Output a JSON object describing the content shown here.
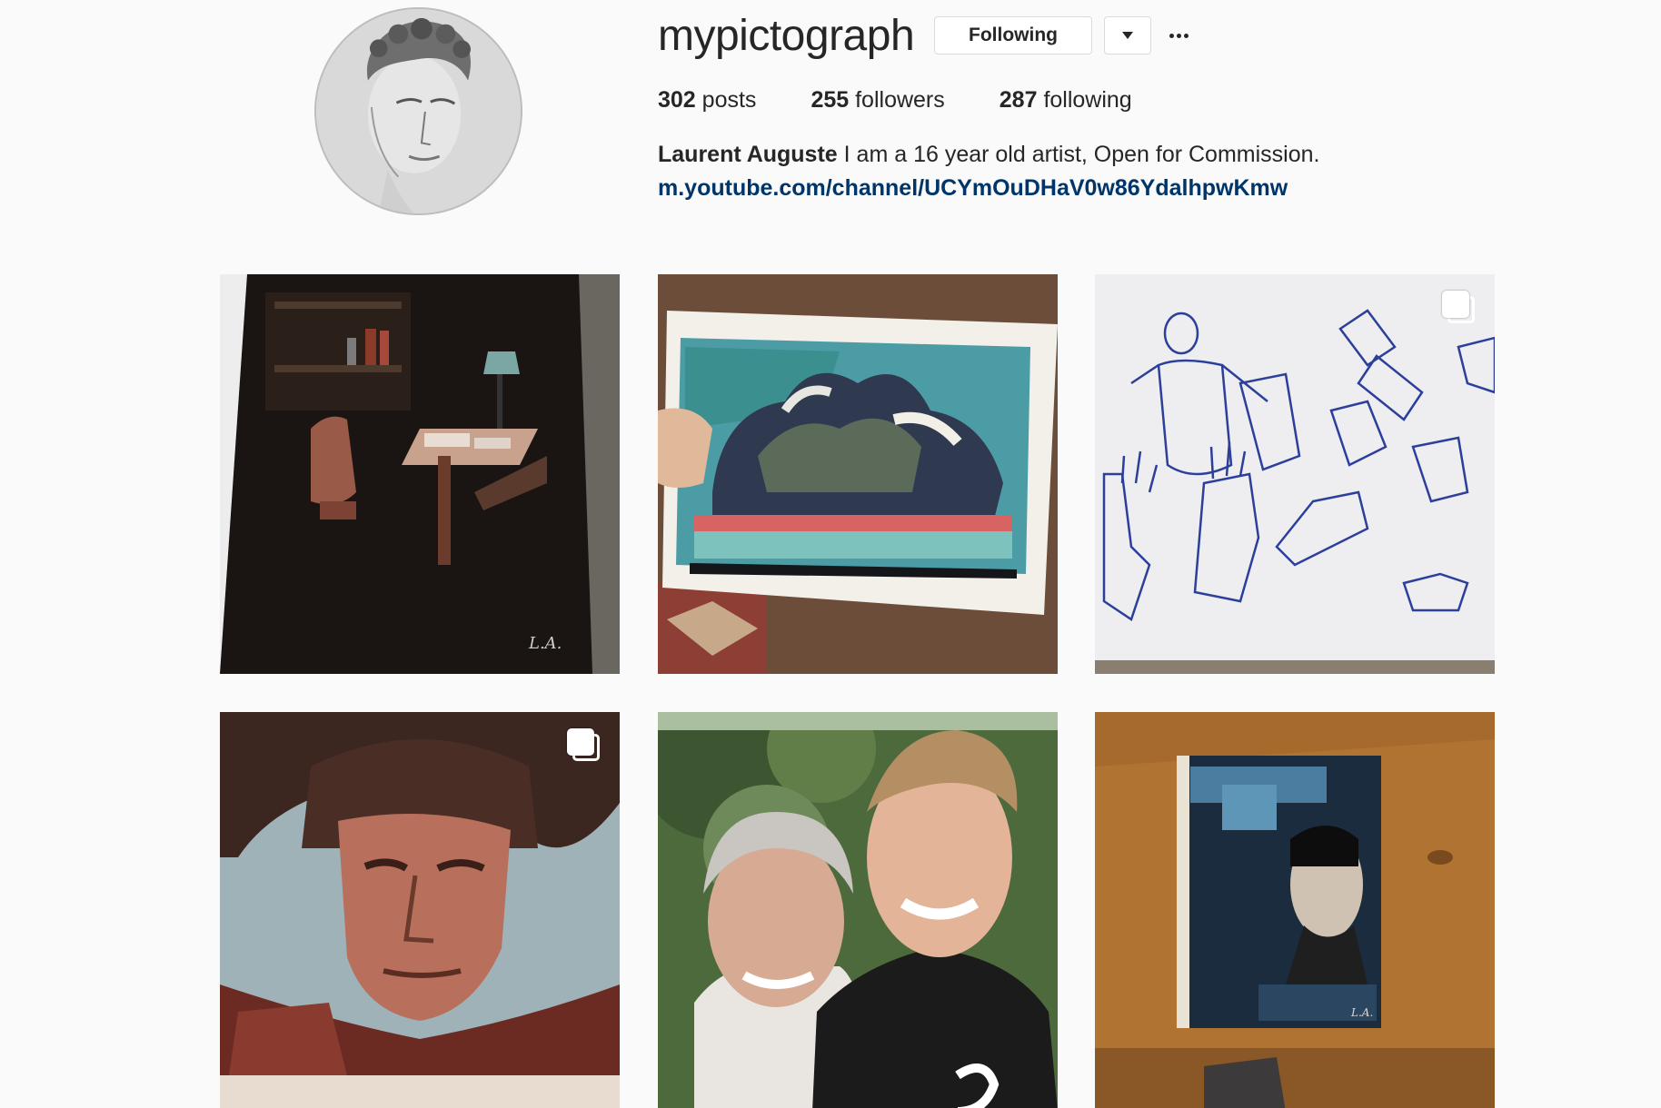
{
  "profile": {
    "username": "mypictograph",
    "follow_label": "Following",
    "posts_count": "302",
    "posts_label": "posts",
    "followers_count": "255",
    "followers_label": "followers",
    "following_count": "287",
    "following_label": "following",
    "full_name": "Laurent Auguste",
    "bio_text": "I am a 16 year old artist, Open for Commission.",
    "website": "m.youtube.com/channel/UCYmOuDHaV0w86YdalhpwKmw"
  },
  "icons": {
    "dropdown": "chevron-down-icon",
    "more": "ellipsis-icon",
    "multi": "carousel-icon"
  },
  "colors": {
    "link": "#003569",
    "text": "#262626",
    "border": "#dbdbdb"
  }
}
